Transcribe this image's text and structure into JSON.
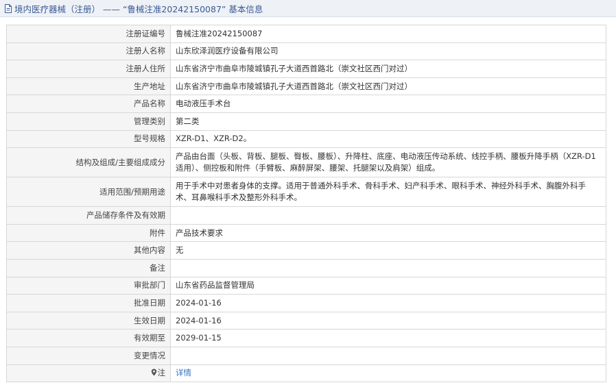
{
  "header": {
    "title": "境内医疗器械（注册） —— “鲁械注准20242150087” 基本信息",
    "icon": "document-icon"
  },
  "rows": [
    {
      "label": "注册证编号",
      "value": "鲁械注准20242150087"
    },
    {
      "label": "注册人名称",
      "value": "山东欣泽润医疗设备有限公司"
    },
    {
      "label": "注册人住所",
      "value": "山东省济宁市曲阜市陵城镇孔子大道西首路北（崇文社区西门对过）"
    },
    {
      "label": "生产地址",
      "value": "山东省济宁市曲阜市陵城镇孔子大道西首路北（崇文社区西门对过）"
    },
    {
      "label": "产品名称",
      "value": "电动液压手术台"
    },
    {
      "label": "管理类别",
      "value": "第二类"
    },
    {
      "label": "型号规格",
      "value": "XZR-D1、XZR-D2。"
    },
    {
      "label": "结构及组成/主要组成成分",
      "value": "产品由台面（头板、背板、腿板、臀板、腰板）、升降柱、底座、电动液压传动系统、线控手柄、腰板升降手柄（XZR-D1适用）、侧控板和附件（手臂板、麻醉屏架、腰架、托腿架以及肩架）组成。"
    },
    {
      "label": "适用范围/预期用途",
      "value": "用于手术中对患者身体的支撑。适用于普通外科手术、骨科手术、妇产科手术、眼科手术、神经外科手术、胸腹外科手术、耳鼻喉科手术及整形外科手术。"
    },
    {
      "label": "产品储存条件及有效期",
      "value": ""
    },
    {
      "label": "附件",
      "value": "产品技术要求"
    },
    {
      "label": "其他内容",
      "value": "无"
    },
    {
      "label": "备注",
      "value": ""
    },
    {
      "label": "审批部门",
      "value": "山东省药品监督管理局"
    },
    {
      "label": "批准日期",
      "value": "2024-01-16"
    },
    {
      "label": "生效日期",
      "value": "2024-01-16"
    },
    {
      "label": "有效期至",
      "value": "2029-01-15"
    },
    {
      "label": "变更情况",
      "value": ""
    }
  ],
  "note_row": {
    "label": "注",
    "link": "详情",
    "icon": "pin-icon"
  },
  "colors": {
    "header_text": "#3a5a95",
    "link": "#2e72c5",
    "label_bg": "#f5f5f5",
    "border": "#d7d7d7"
  }
}
